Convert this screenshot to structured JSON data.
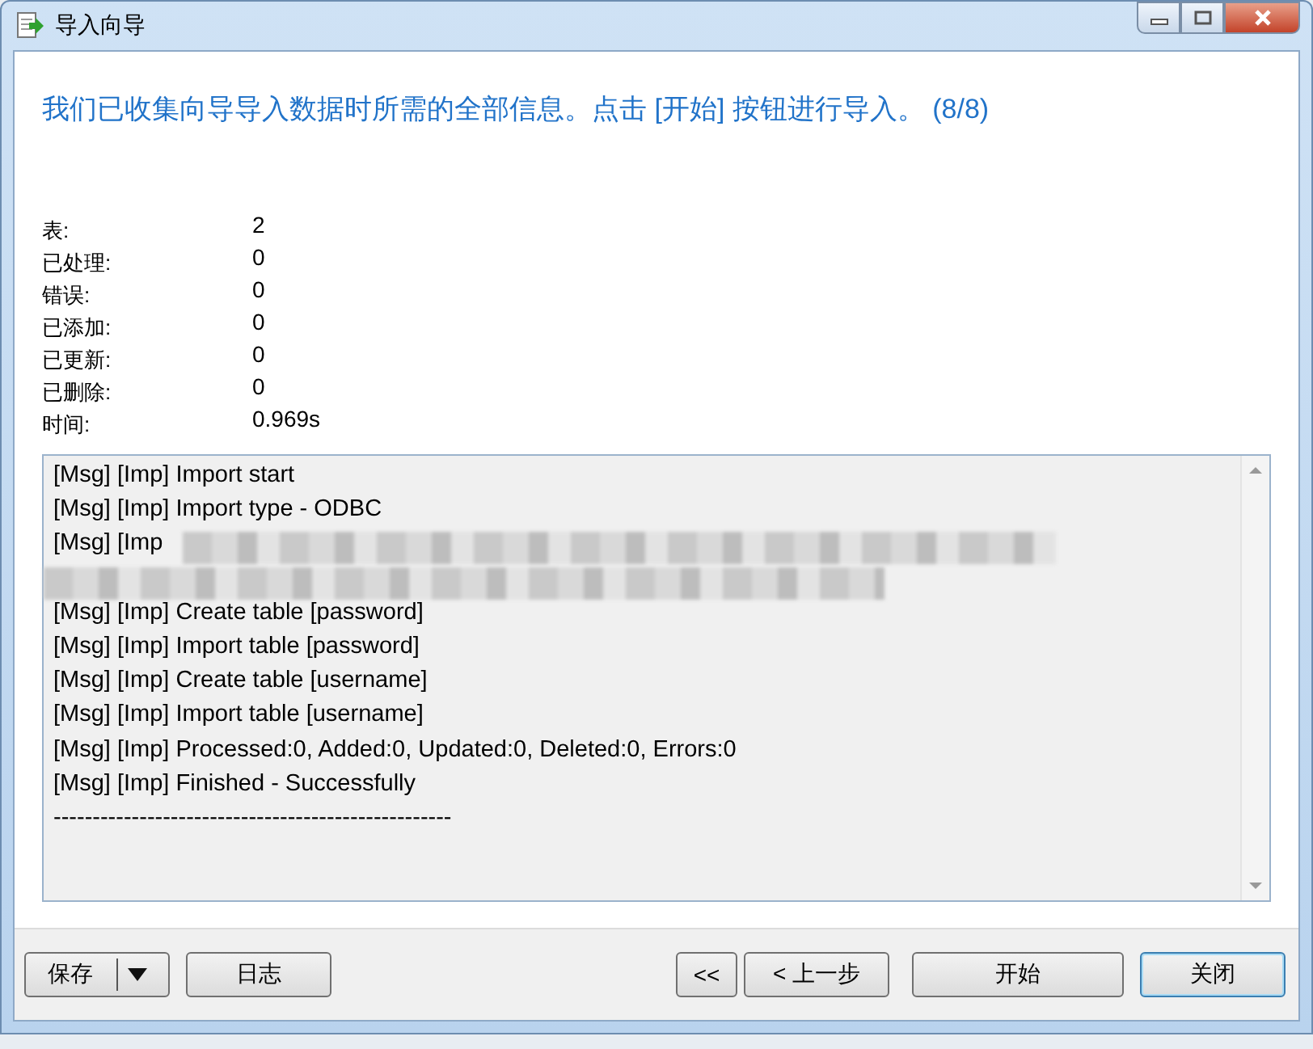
{
  "window": {
    "title": "导入向导"
  },
  "heading": "我们已收集向导导入数据时所需的全部信息。点击 [开始] 按钮进行导入。 (8/8)",
  "stats": [
    {
      "label": "表:",
      "value": "2"
    },
    {
      "label": "已处理:",
      "value": "0"
    },
    {
      "label": "错误:",
      "value": "0"
    },
    {
      "label": "已添加:",
      "value": "0"
    },
    {
      "label": "已更新:",
      "value": "0"
    },
    {
      "label": "已删除:",
      "value": "0"
    },
    {
      "label": "时间:",
      "value": "0.969s"
    }
  ],
  "log": [
    {
      "text": "[Msg] [Imp] Import start",
      "redacted": false
    },
    {
      "text": "[Msg] [Imp] Import type - ODBC",
      "redacted": false
    },
    {
      "text": "[Msg] [Imp",
      "redacted": true
    },
    {
      "redacted": true
    },
    {
      "text": "[Msg] [Imp] Create table [password]",
      "redacted": false
    },
    {
      "text": "[Msg] [Imp] Import table [password]",
      "redacted": false
    },
    {
      "text": "[Msg] [Imp] Create table [username]",
      "redacted": false
    },
    {
      "text": "[Msg] [Imp] Import table [username]",
      "redacted": false
    },
    {
      "text": "[Msg] [Imp] Processed:0, Added:0, Updated:0, Deleted:0, Errors:0",
      "redacted": false
    },
    {
      "text": "[Msg] [Imp] Finished - Successfully",
      "redacted": false
    },
    {
      "text": "---------------------------------------------------",
      "redacted": false
    }
  ],
  "buttons_left": [
    {
      "label": "保存",
      "kind": "split"
    },
    {
      "label": "日志",
      "kind": "plain"
    }
  ],
  "buttons_right": [
    {
      "label": "<<",
      "kind": "small",
      "focused": false
    },
    {
      "label": "< 上一步",
      "kind": "plain",
      "focused": false
    },
    {
      "label": "开始",
      "kind": "wide",
      "focused": false
    },
    {
      "label": "关闭",
      "kind": "plain",
      "focused": true
    }
  ]
}
